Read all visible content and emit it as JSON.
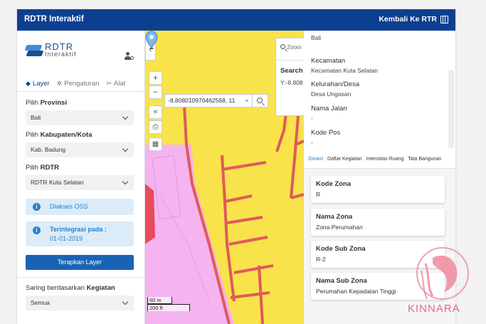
{
  "header": {
    "title": "RDTR Interaktif",
    "back_label": "Kembali Ke RTR"
  },
  "sidebar": {
    "logo_line1": "RDTR",
    "logo_line2": "Interaktif",
    "tabs": [
      {
        "label": "Layer",
        "icon": "layers-icon"
      },
      {
        "label": "Pengaturan",
        "icon": "gear-icon"
      },
      {
        "label": "Alat",
        "icon": "tools-icon"
      }
    ],
    "province": {
      "label_prefix": "Pilih",
      "label_bold": "Provinsi",
      "value": "Bali"
    },
    "city": {
      "label_prefix": "Pilih",
      "label_bold": "Kabupaten/Kota",
      "value": "Kab. Badung"
    },
    "rdtr": {
      "label_prefix": "Pilih",
      "label_bold": "RDTR",
      "value": "RDTR Kuta Selatan"
    },
    "info_oss": "Diakses OSS",
    "info_integrated_label": "Terintegrasi pada :",
    "info_integrated_date": "01-01-2019",
    "apply_button": "Terapkan Layer",
    "filter_prefix": "Saring berdasarkan",
    "filter_bold": "Kegiatan",
    "filter_value": "Semua"
  },
  "map": {
    "coordinate_input": "-8.808010970462568, 11",
    "zoom_search_label": "Zoom",
    "search_label": "Search",
    "y_value": "Y:-8.808",
    "scale_m": "60 m",
    "scale_ft": "200 ft",
    "colors": {
      "residential": "#f8e34a",
      "pink_zone": "#f5b3f0",
      "roads": "#e05a5a"
    }
  },
  "details": {
    "province_value": "Bali",
    "kecamatan_label": "Kecamatan",
    "kecamatan_value": "Kecamatan Kuta Selatan",
    "kelurahan_label": "Kelurahan/Desa",
    "kelurahan_value": "Desa Ungasan",
    "jalan_label": "Nama Jalan",
    "jalan_value": "-",
    "kodepos_label": "Kode Pos",
    "kodepos_value": "-",
    "tabs": [
      "Zonasi",
      "Daftar Kegiatan",
      "Intensitas Ruang",
      "Tata Bangunan"
    ],
    "cards": [
      {
        "label": "Kode Zona",
        "value": "R"
      },
      {
        "label": "Nama Zona",
        "value": "Zona Perumahan"
      },
      {
        "label": "Kode Sub Zona",
        "value": "R-2"
      },
      {
        "label": "Nama Sub Zona",
        "value": "Perumahan Kepadatan Tinggi"
      }
    ]
  },
  "watermark": {
    "text": "KINNARA"
  }
}
